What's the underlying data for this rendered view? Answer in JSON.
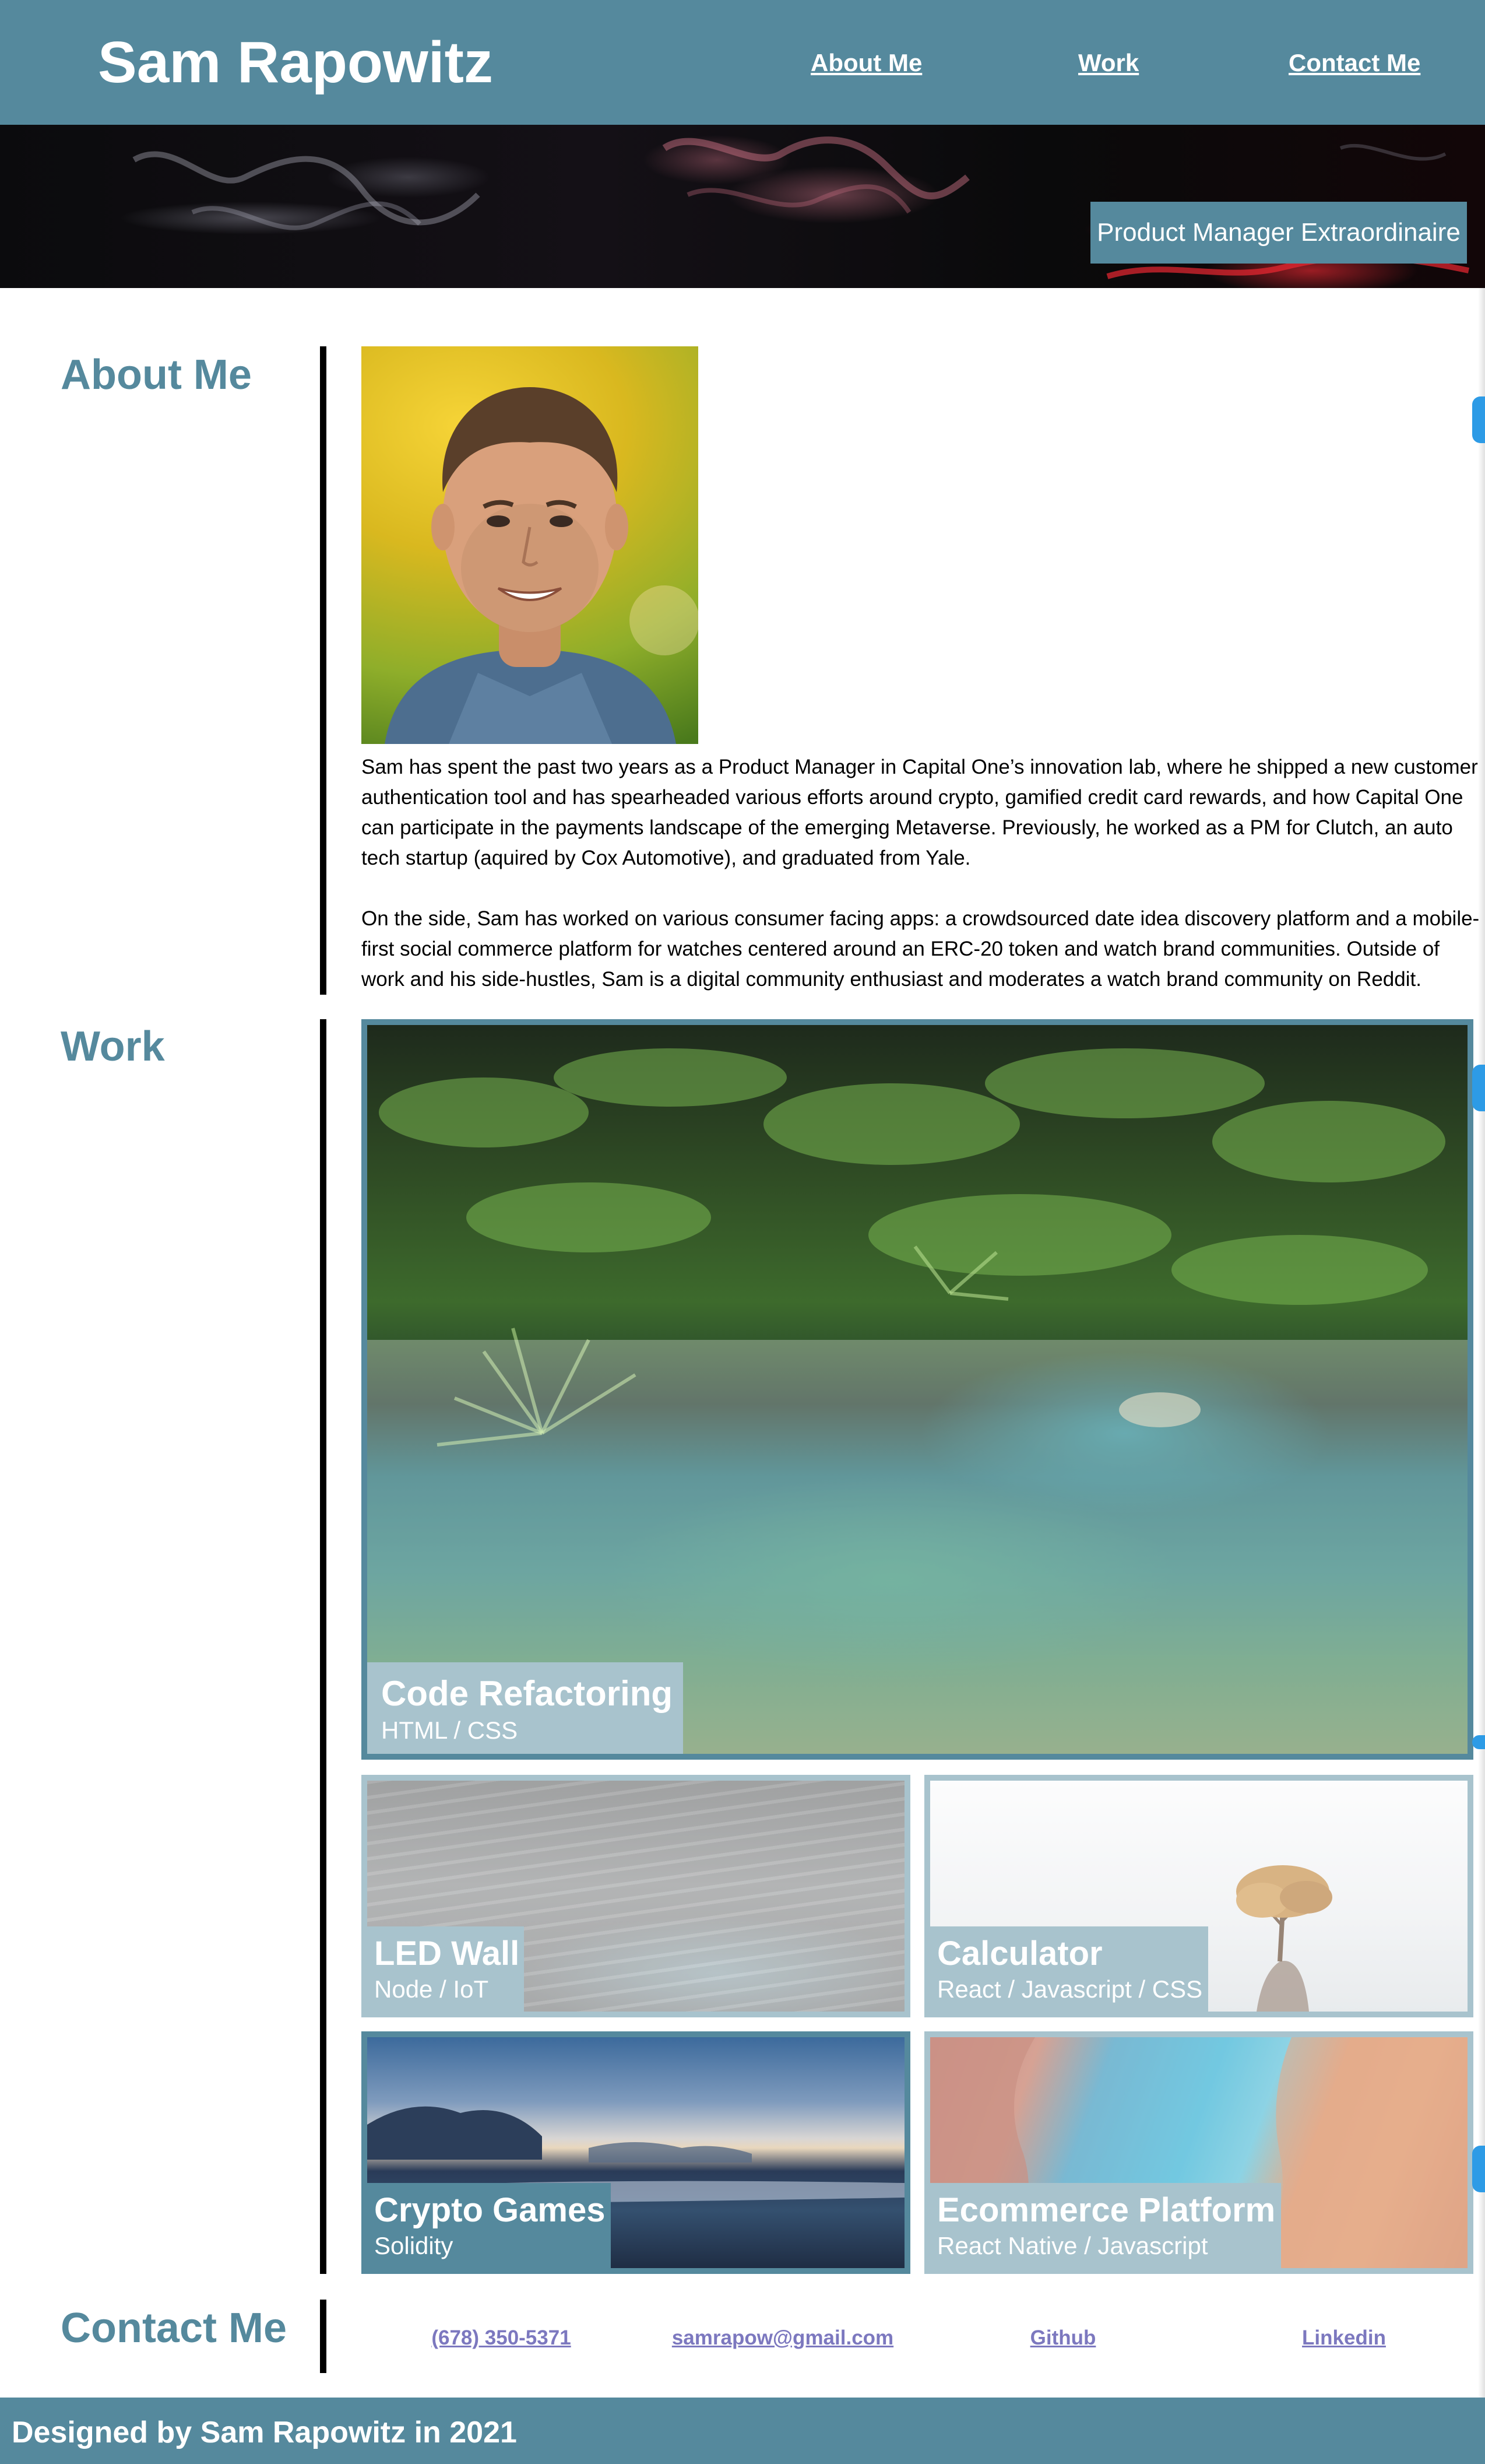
{
  "header": {
    "site_title": "Sam Rapowitz",
    "nav": [
      "About Me",
      "Work",
      "Contact Me"
    ]
  },
  "hero": {
    "tagline": "Product Manager Extraordinaire"
  },
  "about": {
    "heading": "About Me",
    "paragraphs": [
      "Sam has spent the past two years as a Product Manager in Capital One’s innovation lab, where he shipped a new customer authentication tool and has spearheaded various efforts around crypto, gamified credit card rewards, and how Capital One can participate in the payments landscape of the emerging Metaverse. Previously, he worked as a PM for Clutch, an auto tech startup (aquired by Cox Automotive), and graduated from Yale.",
      "On the side, Sam has worked on various consumer facing apps: a crowdsourced date idea discovery platform and a mobile-first social commerce platform for watches centered around an ERC-20 token and watch brand communities. Outside of work and his side-hustles, Sam is a digital community enthusiast and moderates a watch brand community on Reddit."
    ]
  },
  "work": {
    "heading": "Work",
    "projects": [
      {
        "title": "Code Refactoring",
        "tech": "HTML / CSS"
      },
      {
        "title": "LED Wall",
        "tech": "Node / IoT"
      },
      {
        "title": "Calculator",
        "tech": "React / Javascript / CSS"
      },
      {
        "title": "Crypto Games",
        "tech": "Solidity"
      },
      {
        "title": "Ecommerce Platform",
        "tech": "React Native / Javascript"
      }
    ]
  },
  "contact": {
    "heading": "Contact Me",
    "links": [
      "(678) 350-5371",
      "samrapow@gmail.com",
      "Github",
      "Linkedin"
    ]
  },
  "footer": {
    "text": "Designed by Sam Rapowitz in 2021"
  },
  "colors": {
    "brand": "#55899d",
    "caption_light": "#a8c3cd",
    "link": "#7c78bf",
    "edge_widget": "#2d9be6"
  },
  "icons": [
    "portrait-photo",
    "jungle-river-photo",
    "ocean-waves-photo",
    "foggy-tree-photo",
    "coast-sunset-photo",
    "aerial-river-photo"
  ]
}
